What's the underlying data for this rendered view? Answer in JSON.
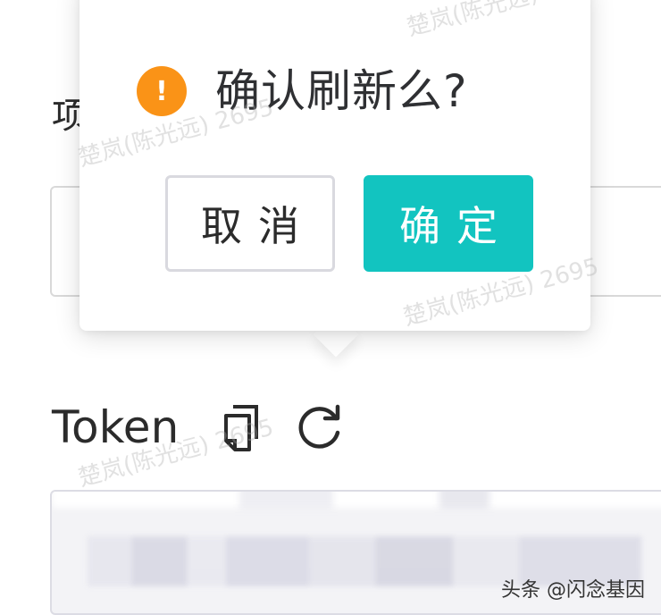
{
  "form": {
    "project_label_partial": "项"
  },
  "popover": {
    "message": "确认刷新么?",
    "warning_icon_glyph": "!",
    "cancel_label": "取消",
    "ok_label": "确定"
  },
  "token": {
    "label": "Token",
    "copy_icon": "copy-icon",
    "refresh_icon": "refresh-icon"
  },
  "watermark": {
    "text": "楚岚(陈光远) 2695"
  },
  "credit": {
    "text": "头条 @闪念基因"
  },
  "colors": {
    "primary": "#12c4c0",
    "warning": "#fa9317",
    "text": "#2f3033",
    "border": "#d9d9df"
  }
}
